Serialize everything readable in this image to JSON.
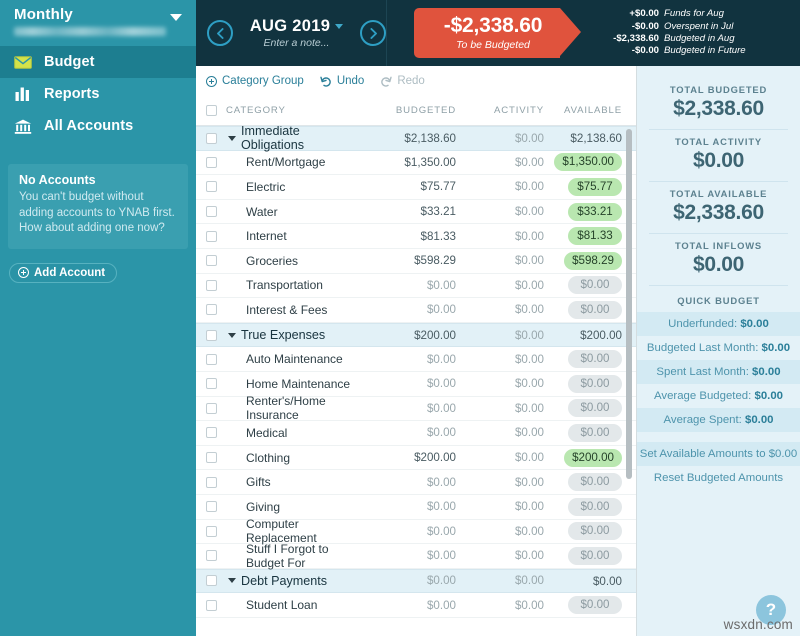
{
  "sidebar": {
    "budget_name": "Monthly",
    "budget_user_redacted": "",
    "nav": [
      {
        "label": "Budget",
        "icon": "envelope-icon",
        "active": true
      },
      {
        "label": "Reports",
        "icon": "bar-chart-icon",
        "active": false
      },
      {
        "label": "All Accounts",
        "icon": "bank-icon",
        "active": false
      }
    ],
    "no_accounts": {
      "title": "No Accounts",
      "body": "You can't budget without adding accounts to YNAB first. How about adding one now?"
    },
    "add_account_label": "Add Account"
  },
  "topbar": {
    "prev_icon": "chevron-left-icon",
    "next_icon": "chevron-right-icon",
    "month": "AUG 2019",
    "note_placeholder": "Enter a note...",
    "to_be_budgeted": {
      "amount": "-$2,338.60",
      "label": "To be Budgeted",
      "color": "#e0533d"
    },
    "breakdown": [
      {
        "amount": "+$0.00",
        "text": "Funds for Aug"
      },
      {
        "amount": "-$0.00",
        "text": "Overspent in Jul"
      },
      {
        "amount": "-$2,338.60",
        "text": "Budgeted in Aug"
      },
      {
        "amount": "-$0.00",
        "text": "Budgeted in Future"
      }
    ]
  },
  "toolbar": {
    "category_group_label": "Category Group",
    "undo_label": "Undo",
    "redo_label": "Redo"
  },
  "table": {
    "headers": {
      "category": "CATEGORY",
      "budgeted": "BUDGETED",
      "activity": "ACTIVITY",
      "available": "AVAILABLE"
    },
    "rows": [
      {
        "type": "group",
        "name": "Immediate Obligations",
        "budgeted": "$2,138.60",
        "activity": "$0.00",
        "available": "$2,138.60",
        "available_state": "group"
      },
      {
        "type": "child",
        "name": "Rent/Mortgage",
        "budgeted": "$1,350.00",
        "activity": "$0.00",
        "available": "$1,350.00",
        "available_state": "pos"
      },
      {
        "type": "child",
        "name": "Electric",
        "budgeted": "$75.77",
        "activity": "$0.00",
        "available": "$75.77",
        "available_state": "pos"
      },
      {
        "type": "child",
        "name": "Water",
        "budgeted": "$33.21",
        "activity": "$0.00",
        "available": "$33.21",
        "available_state": "pos"
      },
      {
        "type": "child",
        "name": "Internet",
        "budgeted": "$81.33",
        "activity": "$0.00",
        "available": "$81.33",
        "available_state": "pos"
      },
      {
        "type": "child",
        "name": "Groceries",
        "budgeted": "$598.29",
        "activity": "$0.00",
        "available": "$598.29",
        "available_state": "pos"
      },
      {
        "type": "child",
        "name": "Transportation",
        "budgeted": "$0.00",
        "activity": "$0.00",
        "available": "$0.00",
        "available_state": "zero"
      },
      {
        "type": "child",
        "name": "Interest & Fees",
        "budgeted": "$0.00",
        "activity": "$0.00",
        "available": "$0.00",
        "available_state": "zero"
      },
      {
        "type": "group",
        "name": "True Expenses",
        "budgeted": "$200.00",
        "activity": "$0.00",
        "available": "$200.00",
        "available_state": "group"
      },
      {
        "type": "child",
        "name": "Auto Maintenance",
        "budgeted": "$0.00",
        "activity": "$0.00",
        "available": "$0.00",
        "available_state": "zero"
      },
      {
        "type": "child",
        "name": "Home Maintenance",
        "budgeted": "$0.00",
        "activity": "$0.00",
        "available": "$0.00",
        "available_state": "zero"
      },
      {
        "type": "child",
        "name": "Renter's/Home Insurance",
        "budgeted": "$0.00",
        "activity": "$0.00",
        "available": "$0.00",
        "available_state": "zero"
      },
      {
        "type": "child",
        "name": "Medical",
        "budgeted": "$0.00",
        "activity": "$0.00",
        "available": "$0.00",
        "available_state": "zero"
      },
      {
        "type": "child",
        "name": "Clothing",
        "budgeted": "$200.00",
        "activity": "$0.00",
        "available": "$200.00",
        "available_state": "pos"
      },
      {
        "type": "child",
        "name": "Gifts",
        "budgeted": "$0.00",
        "activity": "$0.00",
        "available": "$0.00",
        "available_state": "zero"
      },
      {
        "type": "child",
        "name": "Giving",
        "budgeted": "$0.00",
        "activity": "$0.00",
        "available": "$0.00",
        "available_state": "zero"
      },
      {
        "type": "child",
        "name": "Computer Replacement",
        "budgeted": "$0.00",
        "activity": "$0.00",
        "available": "$0.00",
        "available_state": "zero"
      },
      {
        "type": "child",
        "name": "Stuff I Forgot to Budget For",
        "budgeted": "$0.00",
        "activity": "$0.00",
        "available": "$0.00",
        "available_state": "zero"
      },
      {
        "type": "group",
        "name": "Debt Payments",
        "budgeted": "$0.00",
        "activity": "$0.00",
        "available": "$0.00",
        "available_state": "group"
      },
      {
        "type": "child",
        "name": "Student Loan",
        "budgeted": "$0.00",
        "activity": "$0.00",
        "available": "$0.00",
        "available_state": "zero"
      }
    ]
  },
  "inspector": {
    "totals": [
      {
        "label": "TOTAL BUDGETED",
        "value": "$2,338.60"
      },
      {
        "label": "TOTAL ACTIVITY",
        "value": "$0.00"
      },
      {
        "label": "TOTAL AVAILABLE",
        "value": "$2,338.60"
      },
      {
        "label": "TOTAL INFLOWS",
        "value": "$0.00"
      }
    ],
    "quick_budget_header": "QUICK BUDGET",
    "quick_budget_items": [
      {
        "label": "Underfunded: ",
        "value": "$0.00"
      },
      {
        "label": "Budgeted Last Month: ",
        "value": "$0.00"
      },
      {
        "label": "Spent Last Month: ",
        "value": "$0.00"
      },
      {
        "label": "Average Budgeted: ",
        "value": "$0.00"
      },
      {
        "label": "Average Spent: ",
        "value": "$0.00"
      }
    ],
    "actions": [
      {
        "label": "Set Available Amounts to $0.00"
      },
      {
        "label": "Reset Budgeted Amounts"
      }
    ],
    "help_icon": "question-mark-icon"
  },
  "watermark": {
    "text": "wsxdn.com"
  }
}
